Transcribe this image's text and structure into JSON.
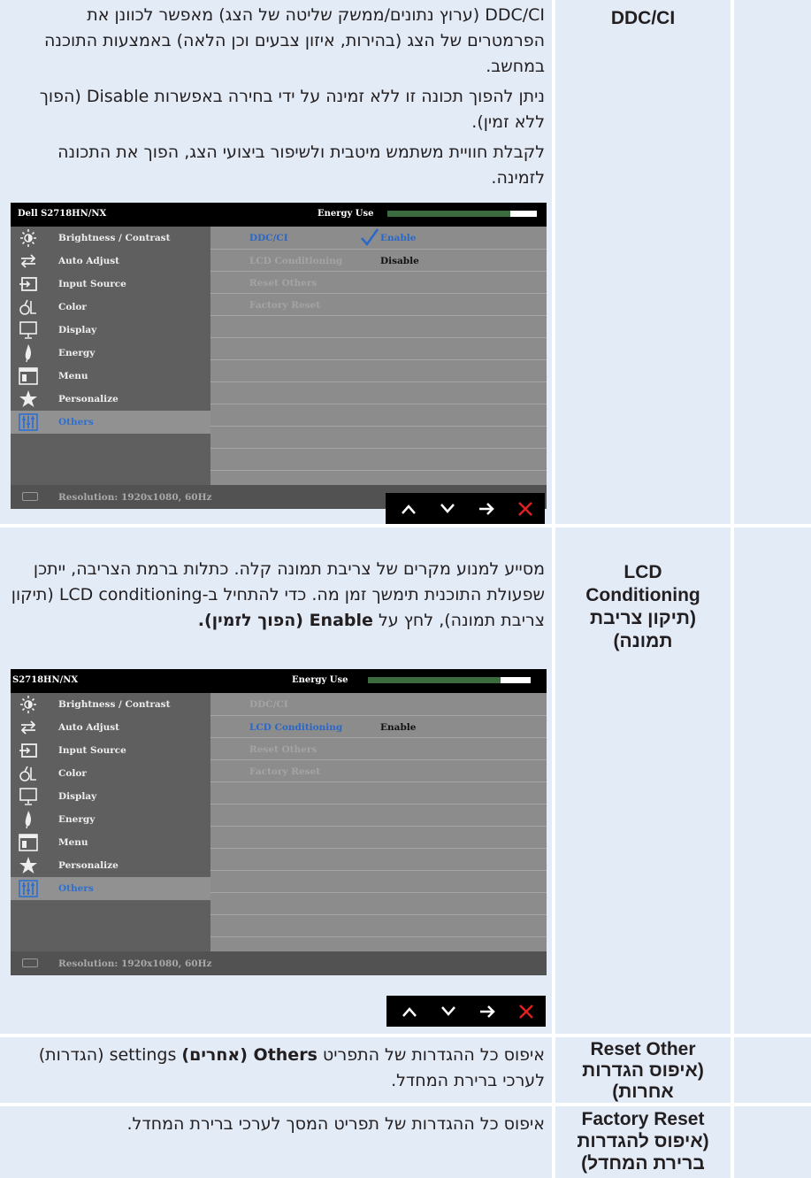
{
  "rows": [
    {
      "header": "DDC/CI",
      "paragraphs": [
        "DDC/CI (ערוץ נתונים/ממשק שליטה של הצג) מאפשר לכוונן את הפרמטרים של הצג (בהירות, איזון צבעים וכן הלאה) באמצעות התוכנה במחשב.",
        "ניתן להפוך תכונה זו ללא זמינה על ידי בחירה באפשרות Disable (הפוך ללא זמין).",
        "לקבלת חוויית משתמש מיטבית ולשיפור ביצועי הצג, הפוך את התכונה לזמינה."
      ]
    },
    {
      "header": "LCD Conditioning (תיקון צריבת תמונה)",
      "paragraph_plain": "מסייע למנוע מקרים של צריבת תמונה קלה. כתלות ברמת הצריבה, ייתכן שפעולת התוכנית תימשך זמן מה. כדי להתחיל ב-LCD conditioning (תיקון צריבת תמונה), לחץ על",
      "paragraph_bold": "Enable (הפוך לזמין)."
    },
    {
      "header": "Reset Other (איפוס הגדרות אחרות)",
      "p_a": "איפוס כל ההגדרות של התפריט",
      "p_bold": "Others (אחרים)",
      "p_b": "settings (הגדרות) לערכי ברירת המחדל."
    },
    {
      "header": "Factory Reset (איפוס להגדרות ברירת המחדל)",
      "paragraph": "איפוס כל ההגדרות של תפריט המסך לערכי ברירת המחדל."
    }
  ],
  "osd1": {
    "model": "Dell S2718HN/NX",
    "energy_label": "Energy Use",
    "energy_level": 0.82,
    "menu": [
      "Brightness / Contrast",
      "Auto Adjust",
      "Input Source",
      "Color",
      "Display",
      "Energy",
      "Menu",
      "Personalize",
      "Others"
    ],
    "selected": "Others",
    "submenu": [
      "DDC/CI",
      "LCD Conditioning",
      "Reset Others",
      "Factory Reset"
    ],
    "active_item": "DDC/CI",
    "values": {
      "ddc": "Enable",
      "lcd": "Disable"
    },
    "resolution": "Resolution: 1920x1080, 60Hz"
  },
  "osd2": {
    "model": "S2718HN/NX",
    "energy_label": "Energy Use",
    "energy_level": 0.82,
    "menu": [
      "Brightness / Contrast",
      "Auto Adjust",
      "Input Source",
      "Color",
      "Display",
      "Energy",
      "Menu",
      "Personalize",
      "Others"
    ],
    "selected": "Others",
    "submenu": [
      "DDC/CI",
      "LCD Conditioning",
      "Reset Others",
      "Factory Reset"
    ],
    "active_item": "LCD Conditioning",
    "values": {
      "lcd": "Enable"
    },
    "resolution": "Resolution: 1920x1080, 60Hz"
  },
  "nav_buttons": [
    "up-icon",
    "down-icon",
    "right-arrow-icon",
    "close-icon"
  ],
  "colors": {
    "cell_bg": "#e3ebf7",
    "border": "#ffffff",
    "osd_selected": "#2f6fd0",
    "energy_bar": "#3d6b40",
    "close": "#e02020"
  }
}
